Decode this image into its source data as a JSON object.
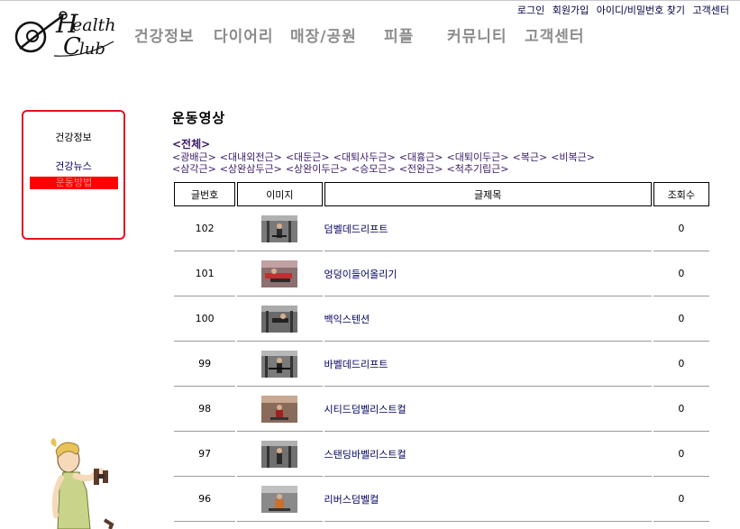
{
  "logo": {
    "text_1": "ealth",
    "text_2": "lub"
  },
  "util_links": [
    "로그인",
    "회원가입",
    "아이디/비밀번호 찾기",
    "고객센터"
  ],
  "nav": [
    "건강정보",
    "다이어리",
    "매장/공원",
    "피플",
    "커뮤니티",
    "고객센터"
  ],
  "side_menu": {
    "title": "건강정보",
    "items": [
      "건강뉴스",
      "운동방법"
    ]
  },
  "page_title": "운동영상",
  "category_all": "<전체>",
  "categories": [
    "<광배근>",
    "<대내외전근>",
    "<대둔근>",
    "<대퇴사두근>",
    "<대흉근>",
    "<대퇴이두근>",
    "<복근>",
    "<비복근>",
    "<삼각근>",
    "<상완삼두근>",
    "<상완이두근>",
    "<승모근>",
    "<전완근>",
    "<척추기립근>"
  ],
  "table": {
    "headers": [
      "글번호",
      "이미지",
      "글제목",
      "조회수"
    ],
    "rows": [
      {
        "no": "102",
        "title": "덤벨데드리프트",
        "views": "0"
      },
      {
        "no": "101",
        "title": "엉덩이들어올리기",
        "views": "0"
      },
      {
        "no": "100",
        "title": "백익스텐션",
        "views": "0"
      },
      {
        "no": "99",
        "title": "바벨데드리프트",
        "views": "0"
      },
      {
        "no": "98",
        "title": "시티드덤벨리스트컬",
        "views": "0"
      },
      {
        "no": "97",
        "title": "스탠딩바벨리스트컬",
        "views": "0"
      },
      {
        "no": "96",
        "title": "리버스덤벨컬",
        "views": "0"
      }
    ]
  },
  "colors": {
    "accent_red": "#e0141e",
    "nav_gray": "#8c8c8c",
    "link_navy": "#000060"
  }
}
